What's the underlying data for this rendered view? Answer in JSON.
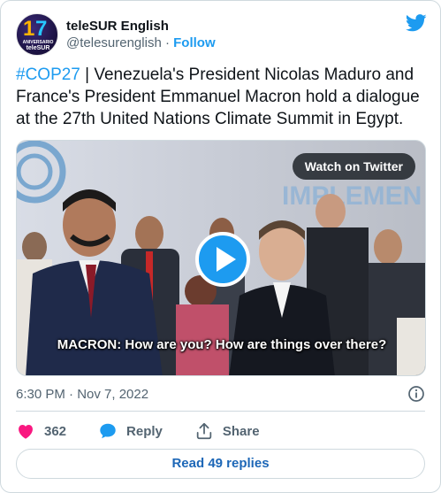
{
  "author": {
    "name": "teleSUR English",
    "handle": "@telesurenglish",
    "separator": "·",
    "follow_label": "Follow",
    "avatar_text_top": "17",
    "avatar_text_line1": "ANIVERSARIO",
    "avatar_text_line2": "teleSUR"
  },
  "tweet": {
    "hashtag": "#COP27",
    "body": " | Venezuela's President Nicolas Maduro and France's President Emmanuel Macron hold a dialogue at the 27th United Nations Climate Summit in Egypt."
  },
  "media": {
    "watch_label": "Watch on Twitter",
    "caption": "MACRON: How are you? How are things over there?",
    "backdrop_text": "IMPLEMEN"
  },
  "meta": {
    "timestamp": "6:30 PM · Nov 7, 2022"
  },
  "actions": {
    "likes": "362",
    "reply_label": "Reply",
    "share_label": "Share"
  },
  "replies_button": {
    "label": "Read 49 replies"
  },
  "colors": {
    "accent": "#1d9bf0",
    "like": "#f91880",
    "muted": "#536471",
    "border": "#cfd9de"
  },
  "icons": [
    "twitter-bird-icon",
    "info-icon",
    "heart-icon",
    "reply-bubble-icon",
    "share-upload-icon",
    "play-icon"
  ]
}
